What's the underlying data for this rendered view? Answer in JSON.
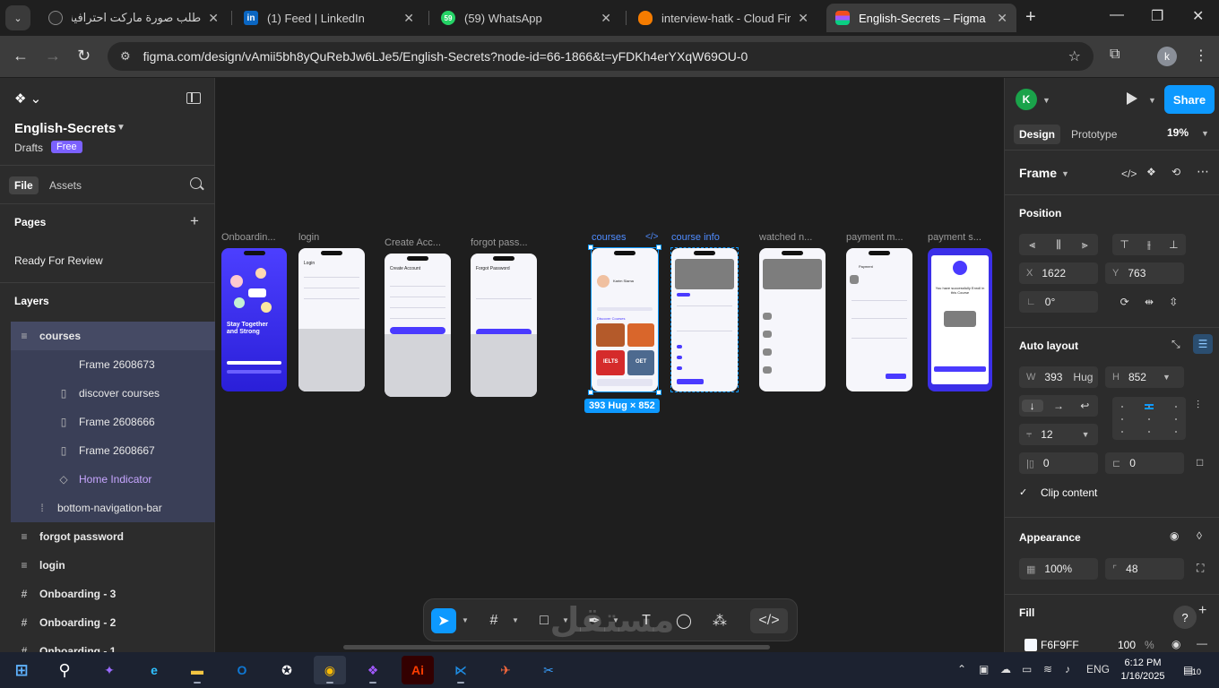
{
  "browser": {
    "tabs": [
      {
        "title": "طلب صورة ماركت احترافية",
        "active": false
      },
      {
        "title": "(1) Feed | LinkedIn",
        "active": false
      },
      {
        "title": "(59) WhatsApp",
        "active": false
      },
      {
        "title": "interview-hatk - Cloud Firest",
        "active": false
      },
      {
        "title": "English-Secrets – Figma",
        "active": true
      }
    ],
    "url": "figma.com/design/vAmii5bh8yQuRebJw6LJe5/English-Secrets?node-id=66-1866&t=yFDKh4erYXqW69OU-0",
    "profile_initial": "k"
  },
  "left_panel": {
    "project_name": "English-Secrets",
    "drafts_label": "Drafts",
    "plan_badge": "Free",
    "tabs": [
      "File",
      "Assets"
    ],
    "pages_heading": "Pages",
    "current_page": "Ready For Review",
    "layers_heading": "Layers",
    "layers": [
      {
        "name": "courses",
        "icon": "≡",
        "indent": 1,
        "state": "selected"
      },
      {
        "name": "Frame 2608673",
        "icon": "",
        "indent": 3,
        "state": "child"
      },
      {
        "name": "discover courses",
        "icon": "▯",
        "indent": 3,
        "state": "child"
      },
      {
        "name": "Frame 2608666",
        "icon": "▯",
        "indent": 3,
        "state": "child"
      },
      {
        "name": "Frame 2608667",
        "icon": "▯",
        "indent": 3,
        "state": "child"
      },
      {
        "name": "Home Indicator",
        "icon": "◇",
        "indent": 3,
        "state": "child-purple"
      },
      {
        "name": "bottom-navigation-bar",
        "icon": "⁞",
        "indent": 2,
        "state": "child"
      },
      {
        "name": "forgot password",
        "icon": "≡",
        "indent": 1,
        "state": "bold"
      },
      {
        "name": "login",
        "icon": "≡",
        "indent": 1,
        "state": "bold"
      },
      {
        "name": "Onboarding - 3",
        "icon": "#",
        "indent": 1,
        "state": "bold"
      },
      {
        "name": "Onboarding - 2",
        "icon": "#",
        "indent": 1,
        "state": "bold"
      },
      {
        "name": "Onboarding - 1",
        "icon": "#",
        "indent": 1,
        "state": "bold"
      }
    ]
  },
  "canvas": {
    "frames": [
      {
        "label": "Onboardin...",
        "style": "onboarding"
      },
      {
        "label": "login",
        "style": "keyboard"
      },
      {
        "label": "Create Acc...",
        "style": "keyboard"
      },
      {
        "label": "forgot pass...",
        "style": "keyboard"
      },
      {
        "label": "courses",
        "style": "courses"
      },
      {
        "label": "course info",
        "style": "info"
      },
      {
        "label": "watched n...",
        "style": "watched"
      },
      {
        "label": "payment m...",
        "style": "payment"
      },
      {
        "label": "payment s...",
        "style": "success"
      }
    ],
    "selection_size": "393 Hug × 852",
    "onboarding_text": "Stay Together and Strong",
    "login_title": "Login",
    "create_title": "Create Account",
    "forgot_title": "Forgot Password",
    "payment_title": "Payment",
    "success_text": "You have successfully Enroll in this Course",
    "courses_section": "Discover Courses",
    "courses_user": "Karim Slama",
    "ielts_label": "IELTS",
    "oet_label": "OET",
    "watermark": "مستقل",
    "watermark_sub": "mostaql.com"
  },
  "right_panel": {
    "avatar_initial": "K",
    "share_label": "Share",
    "tabs": [
      "Design",
      "Prototype"
    ],
    "zoom": "19%",
    "frame_label": "Frame",
    "position_heading": "Position",
    "x_label": "X",
    "x_value": "1622",
    "y_label": "Y",
    "y_value": "763",
    "rotation": "0°",
    "auto_layout_heading": "Auto layout",
    "w_label": "W",
    "w_value": "393",
    "w_mode": "Hug",
    "h_label": "H",
    "h_value": "852",
    "gap": "12",
    "padding_h": "0",
    "padding_v": "0",
    "clip_content": "Clip content",
    "appearance_heading": "Appearance",
    "opacity": "100%",
    "corner_radius": "48",
    "fill_heading": "Fill",
    "fill_hex": "F6F9FF",
    "fill_opacity": "100",
    "fill_percent": "%",
    "fill_color": "#F6F9FF"
  },
  "taskbar": {
    "lang": "ENG",
    "time": "6:12 PM",
    "date": "1/16/2025",
    "notifications": "10"
  }
}
